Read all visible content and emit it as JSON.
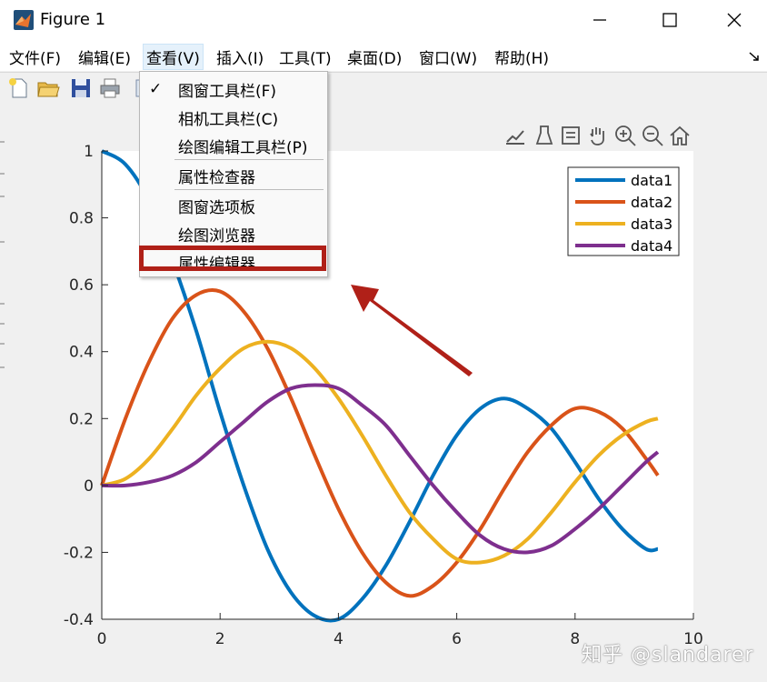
{
  "window": {
    "title": "Figure 1",
    "icon": "matlab-icon"
  },
  "menubar": {
    "items": [
      {
        "label": "文件(F)"
      },
      {
        "label": "编辑(E)"
      },
      {
        "label": "查看(V)"
      },
      {
        "label": "插入(I)"
      },
      {
        "label": "工具(T)"
      },
      {
        "label": "桌面(D)"
      },
      {
        "label": "窗口(W)"
      },
      {
        "label": "帮助(H)"
      }
    ],
    "active_index": 2
  },
  "view_menu": {
    "items": [
      {
        "label": "图窗工具栏(F)",
        "checked": true
      },
      {
        "label": "相机工具栏(C)",
        "checked": false
      },
      {
        "label": "绘图编辑工具栏(P)",
        "checked": false
      },
      {
        "label": "属性检查器",
        "checked": false
      },
      {
        "label": "图窗选项板",
        "checked": false
      },
      {
        "label": "绘图浏览器",
        "checked": false
      },
      {
        "label": "属性编辑器",
        "checked": false,
        "highlighted": true
      }
    ],
    "check_glyph": "✓"
  },
  "watermark": "知乎 @slandarer",
  "colors": {
    "annotation_red": "#b02018",
    "data1": "#0072BD",
    "data2": "#D95319",
    "data3": "#EDB120",
    "data4": "#7E2F8E"
  },
  "chart_data": {
    "type": "line",
    "xlim": [
      0,
      10
    ],
    "ylim": [
      -0.4,
      1
    ],
    "xticks": [
      "0",
      "2",
      "4",
      "6",
      "8",
      "10"
    ],
    "yticks": [
      "-0.4",
      "-0.2",
      "0",
      "0.2",
      "0.4",
      "0.6",
      "0.8",
      "1"
    ],
    "legend_position": "top-right",
    "grid": false,
    "x": [
      0,
      0.4,
      0.8,
      1.2,
      1.6,
      2.0,
      2.4,
      2.8,
      3.2,
      3.6,
      4.0,
      4.4,
      4.8,
      5.2,
      5.6,
      6.0,
      6.4,
      6.8,
      7.2,
      7.6,
      8.0,
      8.4,
      8.8,
      9.2,
      9.4
    ],
    "series": [
      {
        "name": "data1",
        "values": [
          1.0,
          0.96,
          0.85,
          0.67,
          0.46,
          0.22,
          0.0,
          -0.19,
          -0.32,
          -0.39,
          -0.4,
          -0.34,
          -0.24,
          -0.11,
          0.03,
          0.15,
          0.23,
          0.26,
          0.23,
          0.17,
          0.07,
          -0.04,
          -0.13,
          -0.19,
          -0.19
        ]
      },
      {
        "name": "data2",
        "values": [
          0.0,
          0.2,
          0.37,
          0.5,
          0.57,
          0.58,
          0.52,
          0.41,
          0.26,
          0.09,
          -0.07,
          -0.2,
          -0.29,
          -0.33,
          -0.3,
          -0.23,
          -0.13,
          -0.01,
          0.1,
          0.18,
          0.23,
          0.22,
          0.17,
          0.08,
          0.03
        ]
      },
      {
        "name": "data3",
        "values": [
          0.0,
          0.02,
          0.08,
          0.17,
          0.27,
          0.35,
          0.41,
          0.43,
          0.41,
          0.35,
          0.26,
          0.15,
          0.03,
          -0.08,
          -0.16,
          -0.22,
          -0.23,
          -0.21,
          -0.16,
          -0.08,
          0.01,
          0.09,
          0.15,
          0.19,
          0.2
        ]
      },
      {
        "name": "data4",
        "values": [
          0.0,
          0.0,
          0.01,
          0.03,
          0.07,
          0.13,
          0.19,
          0.25,
          0.29,
          0.3,
          0.29,
          0.24,
          0.18,
          0.09,
          0.0,
          -0.08,
          -0.15,
          -0.19,
          -0.2,
          -0.18,
          -0.13,
          -0.07,
          0.0,
          0.07,
          0.1
        ]
      }
    ]
  }
}
